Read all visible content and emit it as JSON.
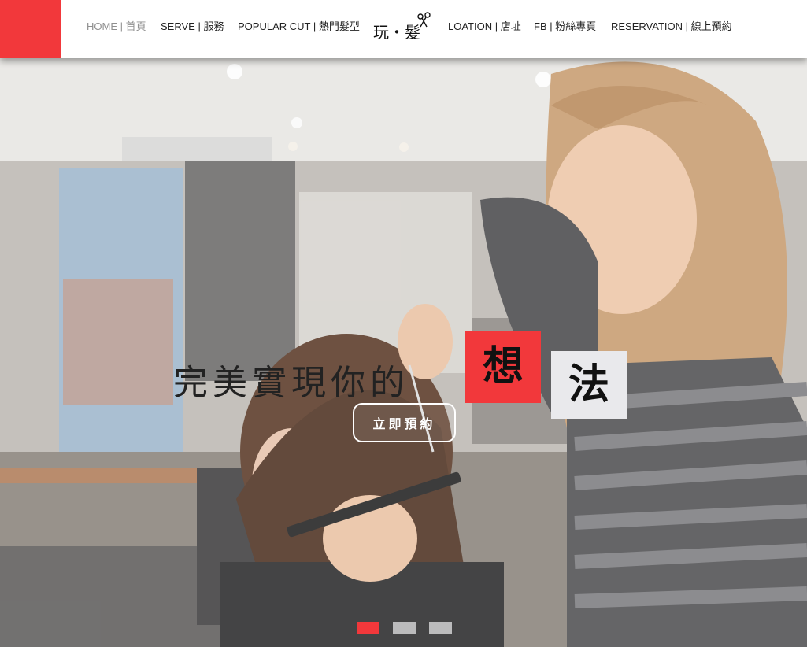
{
  "nav": {
    "home": "HOME | 首頁",
    "serve": "SERVE | 服務",
    "popular": "POPULAR CUT | 熱門髮型",
    "location": "LOATION | 店址",
    "fb": "FB | 粉絲專頁",
    "reservation": "RESERVATION | 線上預約"
  },
  "logo": {
    "text": "玩・髮"
  },
  "hero": {
    "headline": "完美實現你的",
    "highlight_red": "想",
    "highlight_white": "法",
    "cta": "立即預約"
  },
  "carousel": {
    "slides": 3,
    "active_index": 0
  },
  "colors": {
    "accent": "#f2383b",
    "nav_text": "#222222",
    "nav_active": "#8f8f8f"
  }
}
